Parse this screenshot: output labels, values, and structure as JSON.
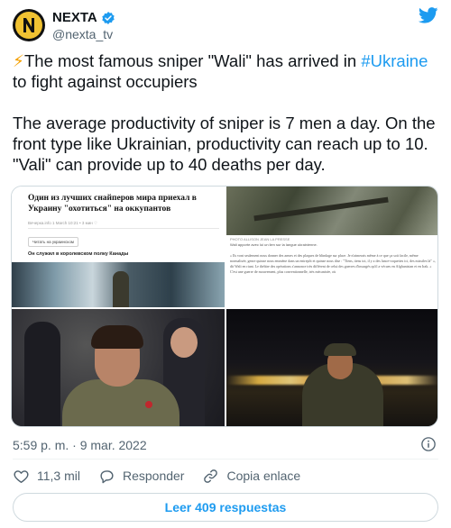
{
  "account": {
    "display_name": "NEXTA",
    "handle": "@nexta_tv",
    "avatar_letter": "N"
  },
  "tweet": {
    "bolt": "⚡",
    "line1_pre": "The most famous sniper \"Wali\" has arrived in ",
    "hashtag": "#Ukraine",
    "line1_post": " to fight against occupiers",
    "para2": "The average productivity of sniper is 7 men a day.  On the front type like Ukrainian, productivity can reach up to 10. \"Vali\" can provide up to 40 deaths per day."
  },
  "media": {
    "article": {
      "headline": "Один из лучших снайперов мира приехал в Украину \"охотиться\" на оккупантов",
      "meta": "Вечерка.info  1 March 10:21                                  • 3 мин    ♡",
      "chip": "Читать на украинском",
      "subheading": "Он служил в королевском полку Канады"
    },
    "french_article": {
      "caption": "PHOTO ALLISON JEAN LA PRESSE",
      "caption2": "Wali apporte avec lui un lien sur la langue ukrainienne.",
      "body": "« Ils vont seulement nous donner des armes et des plaques de blindage sur place. Je n'aimerais même à ce que ça soit facile, même normalisée, genre quinze nous emmène dans un entrepôt et quinze nous dise : \"Tiens, tiens toi, il y a des lance-roquettes ici, des missiles là\" », dit Wali en riant. Le théâtre des opérations s'annonce très différent de celui des guerres d'insurgés qu'il a vécues en Afghanistan et en Irak. « C'est une guerre de mouvement, plus conventionnelle, très mécanisée, où"
    }
  },
  "meta": {
    "timestamp": "5:59 p. m. · 9 mar. 2022"
  },
  "actions": {
    "likes": "11,3 mil",
    "reply": "Responder",
    "copy_link": "Copia enlace"
  },
  "replies_button": "Leer 409 respuestas",
  "icons": {
    "avatar": "nexta-logo-icon",
    "verified": "verified-badge-icon",
    "brand": "twitter-bird-icon",
    "info": "info-icon",
    "like": "heart-icon",
    "reply": "speech-bubble-icon",
    "link": "link-icon"
  },
  "colors": {
    "accent": "#1d9bf0",
    "text_primary": "#0f1419",
    "text_secondary": "#536471",
    "avatar_yellow": "#f1c232"
  }
}
